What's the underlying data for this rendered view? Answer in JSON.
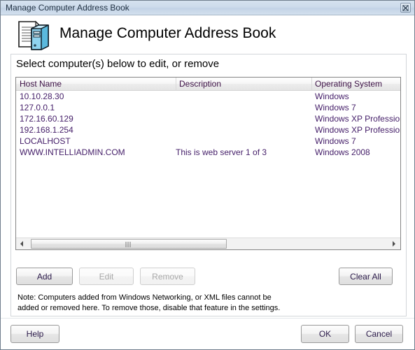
{
  "window": {
    "title": "Manage Computer Address Book",
    "close_button_label": "Close"
  },
  "header": {
    "title": "Manage Computer Address Book",
    "icon": "computer-documents-icon"
  },
  "group": {
    "label": "Select computer(s) below to edit, or remove"
  },
  "list": {
    "columns": [
      "Host Name",
      "Description",
      "Operating System"
    ],
    "rows": [
      {
        "host": "10.10.28.30",
        "description": "",
        "os": "Windows"
      },
      {
        "host": "127.0.0.1",
        "description": "",
        "os": "Windows 7"
      },
      {
        "host": "172.16.60.129",
        "description": "",
        "os": "Windows XP Professional"
      },
      {
        "host": "192.168.1.254",
        "description": "",
        "os": "Windows XP Professional"
      },
      {
        "host": "LOCALHOST",
        "description": "",
        "os": "Windows 7"
      },
      {
        "host": "WWW.INTELLIADMIN.COM",
        "description": "This is web server 1 of 3",
        "os": "Windows 2008"
      }
    ],
    "header_text_color": "#3b0f44",
    "row_text_color": "#46206a"
  },
  "scrollbar": {
    "left_arrow": "scroll-left-arrow-icon",
    "right_arrow": "scroll-right-arrow-icon"
  },
  "actions": {
    "add": "Add",
    "edit": "Edit",
    "remove": "Remove",
    "clear_all": "Clear All"
  },
  "note": {
    "line1": "Note: Computers added from Windows Networking, or XML files cannot be",
    "line2": "added or removed here. To remove those, disable that feature in the settings."
  },
  "footer": {
    "help": "Help",
    "ok": "OK",
    "cancel": "Cancel"
  }
}
